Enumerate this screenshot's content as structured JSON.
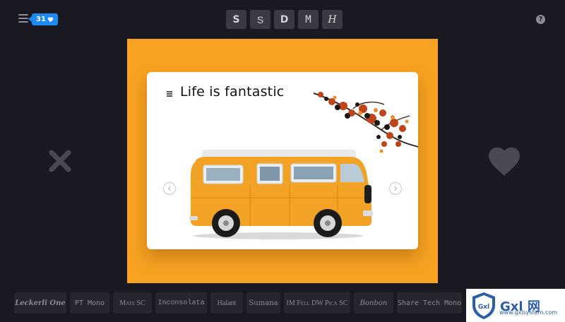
{
  "header": {
    "likes_count": "31",
    "font_options": [
      "S",
      "S",
      "D",
      "M",
      "H"
    ]
  },
  "card": {
    "title": "Life is fantastic"
  },
  "font_bar": {
    "fonts": [
      "Leckerli One",
      "PT Mono",
      "Mate SC",
      "Inconsolata",
      "Halant",
      "Sumana",
      "IM Fell DW Pica SC",
      "Bonbon",
      "Share Tech Mono"
    ]
  },
  "watermark": {
    "brand": "Gxl 网",
    "url": "www.gxlsystem.com",
    "badge": "Gxl"
  },
  "colors": {
    "background": "#1a1922",
    "stage": "#f7a221",
    "badge": "#1d8bf1",
    "van": "#f2a224"
  },
  "icons": [
    "menu-icon",
    "heart-icon",
    "help-icon",
    "close-x-icon",
    "big-heart-icon",
    "chevron-left-icon",
    "chevron-right-icon"
  ]
}
